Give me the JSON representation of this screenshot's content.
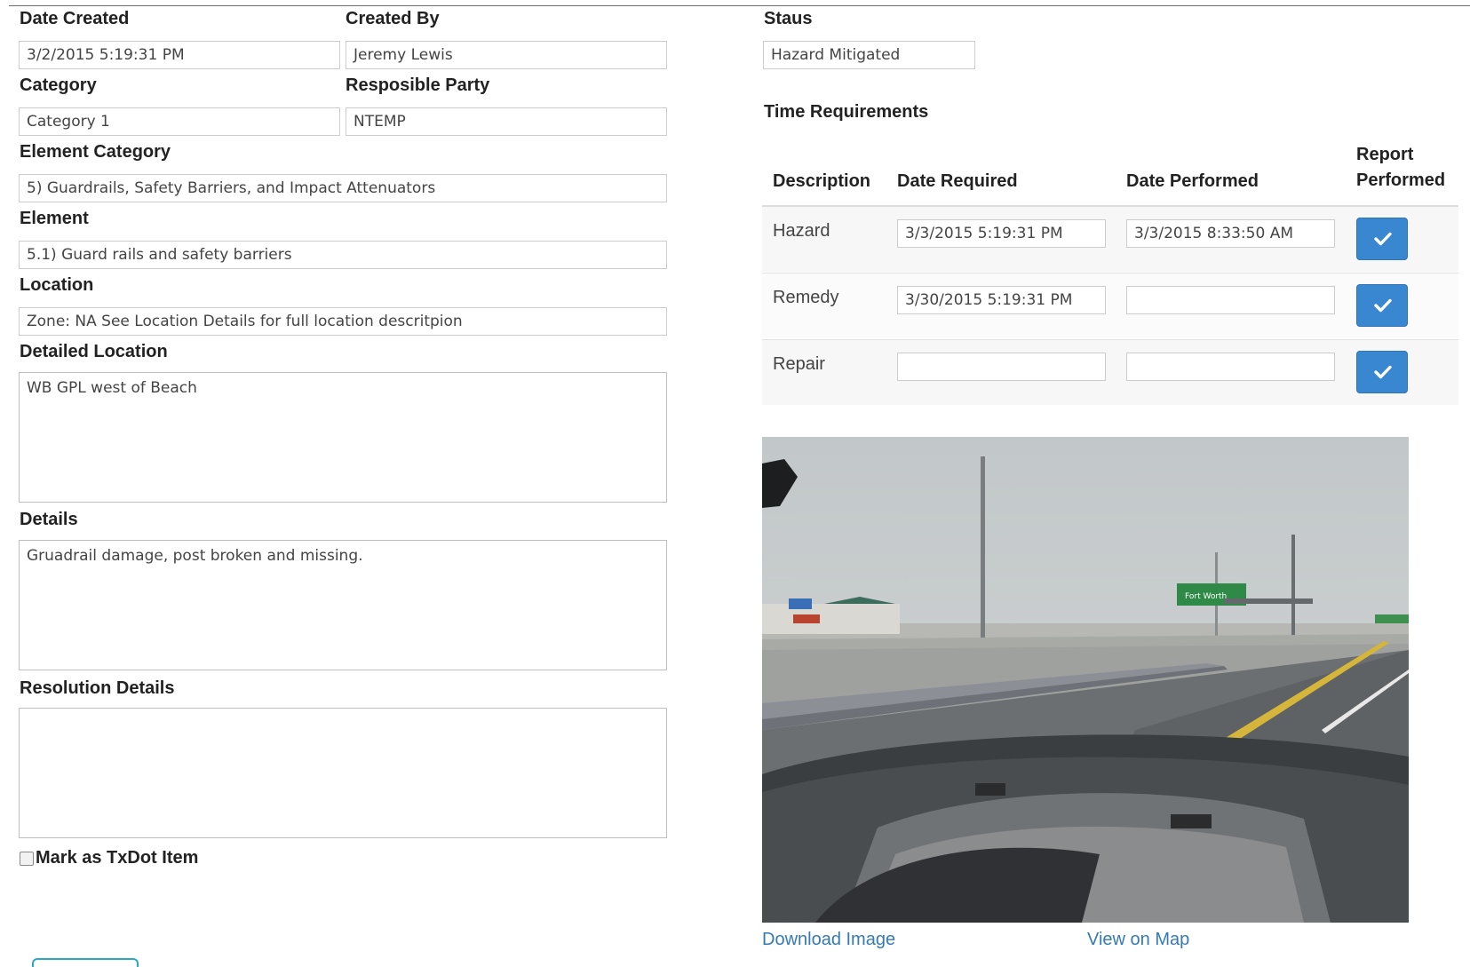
{
  "form": {
    "date_created_label": "Date Created",
    "date_created_value": "3/2/2015 5:19:31 PM",
    "created_by_label": "Created By",
    "created_by_value": "Jeremy Lewis",
    "category_label": "Category",
    "category_value": "Category 1",
    "responsible_party_label": "Resposible Party",
    "responsible_party_value": "NTEMP",
    "element_category_label": "Element Category",
    "element_category_value": "5) Guardrails, Safety Barriers, and Impact Attenuators",
    "element_label": "Element",
    "element_value": "5.1) Guard rails and safety barriers",
    "location_label": "Location",
    "location_value": "Zone: NA See Location Details for full location descritpion",
    "detailed_location_label": "Detailed Location",
    "detailed_location_value": "WB GPL west of Beach",
    "details_label": "Details",
    "details_value": "Gruadrail damage, post broken and missing.",
    "resolution_details_label": "Resolution Details",
    "resolution_details_value": "",
    "txdot_label": "Mark as TxDot Item",
    "txdot_checked": false
  },
  "status": {
    "label": "Staus",
    "value": "Hazard Mitigated"
  },
  "time_requirements": {
    "title": "Time Requirements",
    "headers": {
      "description": "Description",
      "date_required": "Date Required",
      "date_performed": "Date Performed",
      "report_performed_line1": "Report",
      "report_performed_line2": "Performed"
    },
    "rows": [
      {
        "description": "Hazard",
        "date_required": "3/3/2015 5:19:31 PM",
        "date_performed": "3/3/2015 8:33:50 AM"
      },
      {
        "description": "Remedy",
        "date_required": "3/30/2015 5:19:31 PM",
        "date_performed": ""
      },
      {
        "description": "Repair",
        "date_required": "",
        "date_performed": ""
      }
    ]
  },
  "photo": {
    "sign_text": "Fort Worth"
  },
  "links": {
    "download_image": "Download Image",
    "view_on_map": "View on Map"
  },
  "colors": {
    "accent": "#3a87d1",
    "link": "#337ab7"
  }
}
